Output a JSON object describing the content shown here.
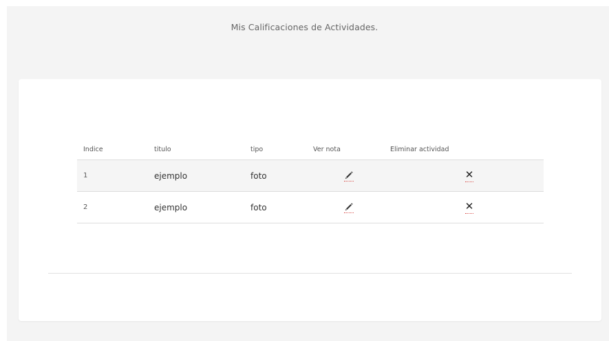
{
  "page": {
    "title": "Mis Calificaciones de Actividades."
  },
  "table": {
    "headers": {
      "indice": "Indice",
      "titulo": "titulo",
      "tipo": "tipo",
      "ver_nota": "Ver nota",
      "eliminar": "Eliminar actividad"
    },
    "rows": [
      {
        "indice": "1",
        "titulo": "ejemplo",
        "tipo": "foto",
        "ver_icon": "pencil-icon",
        "eliminar_icon": "close-icon"
      },
      {
        "indice": "2",
        "titulo": "ejemplo",
        "tipo": "foto",
        "ver_icon": "pencil-icon",
        "eliminar_icon": "close-icon"
      }
    ]
  },
  "colors": {
    "background": "#f4f4f4",
    "card": "#ffffff",
    "row_stripe": "#f5f5f5",
    "link_underline": "#d9534f"
  }
}
